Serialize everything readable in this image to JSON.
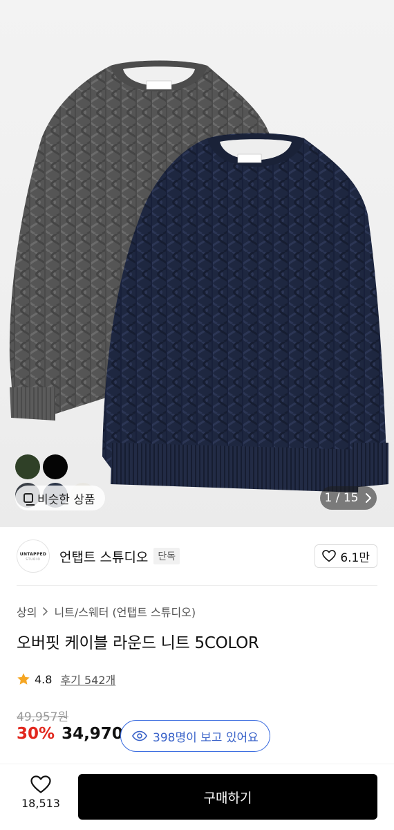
{
  "hero": {
    "similar_label": "비슷한 상품",
    "pager_text": "1 / 15",
    "pager_icon": "chevron-right-icon",
    "swatch_colors": [
      "#2f4027",
      "#050505",
      "#3a3f47",
      "#2a3447",
      "#e8e6e1"
    ]
  },
  "brand": {
    "logo_line1": "UNTAPPED",
    "logo_line2": "STUDIO",
    "name": "언탭트 스튜디오",
    "tag": "단독",
    "likes": "6.1만"
  },
  "product": {
    "breadcrumb": [
      "상의",
      "니트/스웨터 (언탭트 스튜디오)"
    ],
    "title": "오버핏 케이블 라운드 니트 5COLOR",
    "rating": "4.8",
    "reviews": "후기 542개",
    "original_price": "49,957원",
    "discount": "30%",
    "price": "34,970",
    "viewers": "398명이 보고 있어요"
  },
  "bottom": {
    "wish_count": "18,513",
    "buy_label": "구매하기"
  },
  "colors": {
    "accent_red": "#e1271d",
    "viewer_blue": "#3a63c9",
    "buy_bg": "#000000"
  }
}
